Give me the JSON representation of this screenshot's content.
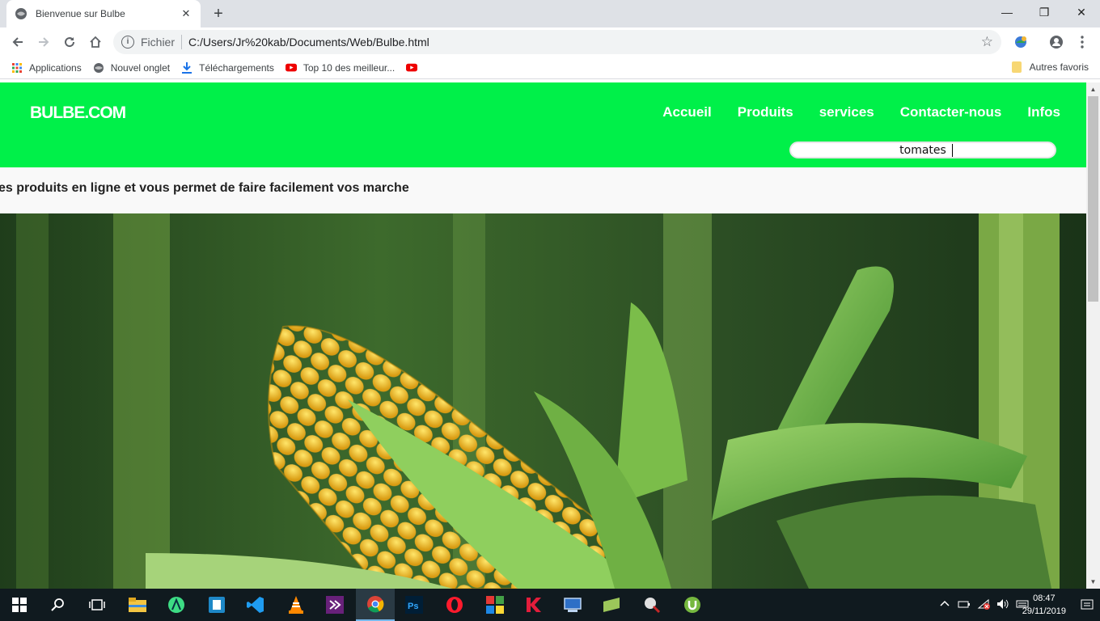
{
  "browser": {
    "tab_title": "Bienvenue sur Bulbe",
    "tab_close": "✕",
    "new_tab": "+",
    "window": {
      "minimize": "—",
      "maximize": "❐",
      "close": "✕"
    },
    "address": {
      "scheme_label": "Fichier",
      "url": "C:/Users/Jr%20kab/Documents/Web/Bulbe.html"
    },
    "bookmarks": [
      {
        "label": "Applications",
        "icon": "apps-grid-icon"
      },
      {
        "label": "Nouvel onglet",
        "icon": "globe-icon"
      },
      {
        "label": "Téléchargements",
        "icon": "download-icon"
      },
      {
        "label": "Top 10 des meilleur...",
        "icon": "youtube-icon"
      },
      {
        "label": "",
        "icon": "youtube-icon"
      }
    ],
    "other_bookmarks": "Autres favoris"
  },
  "site": {
    "logo": "BULBE.COM",
    "nav": [
      "Accueil",
      "Produits",
      "services",
      "Contacter-nous",
      "Infos"
    ],
    "search_value": "tomates",
    "tagline": "es produits en ligne et vous permet de faire facilement vos marche",
    "colors": {
      "header": "#00f049",
      "band": "#f9f9f9"
    }
  },
  "taskbar": {
    "time": "08:47",
    "date": "29/11/2019",
    "apps": [
      "start-icon",
      "search-icon",
      "task-view-icon",
      "file-explorer-icon",
      "android-studio-icon",
      "app-icon",
      "vscode-icon",
      "vlc-icon",
      "visual-studio-icon",
      "chrome-icon",
      "photoshop-icon",
      "opera-icon",
      "app-icon",
      "kaspersky-icon",
      "app-icon",
      "app-icon",
      "app-icon",
      "utorrent-icon"
    ]
  }
}
